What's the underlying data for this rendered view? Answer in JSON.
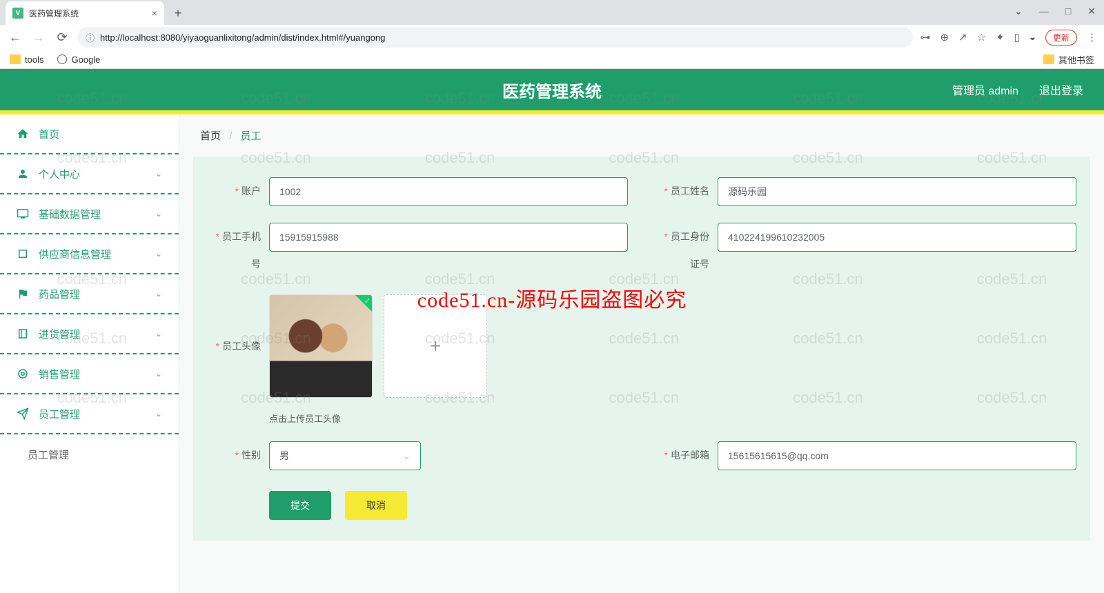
{
  "browser": {
    "tab_title": "医药管理系统",
    "url_host": "localhost",
    "url_full": "http://localhost:8080/yiyaoguanlixitong/admin/dist/index.html#/yuangong",
    "new_tab": "+",
    "update_label": "更新",
    "bookmarks": {
      "tools": "tools",
      "google": "Google",
      "other": "其他书签"
    }
  },
  "header": {
    "title": "医药管理系统",
    "user_label": "管理员 admin",
    "logout": "退出登录"
  },
  "sidebar": {
    "items": [
      {
        "label": "首页"
      },
      {
        "label": "个人中心"
      },
      {
        "label": "基础数据管理"
      },
      {
        "label": "供应商信息管理"
      },
      {
        "label": "药品管理"
      },
      {
        "label": "进货管理"
      },
      {
        "label": "销售管理"
      },
      {
        "label": "员工管理"
      }
    ],
    "sub_item": "员工管理"
  },
  "breadcrumb": {
    "home": "首页",
    "sep": "/",
    "current": "员工"
  },
  "form": {
    "account": {
      "label": "账户",
      "value": "1002"
    },
    "name": {
      "label": "员工姓名",
      "value": "源码乐园"
    },
    "phone": {
      "label": "员工手机号",
      "value": "15915915988"
    },
    "idcard": {
      "label": "员工身份证号",
      "value": "410224199610232005"
    },
    "avatar": {
      "label": "员工头像",
      "hint": "点击上传员工头像"
    },
    "gender": {
      "label": "性别",
      "value": "男"
    },
    "email": {
      "label": "电子邮箱",
      "value": "15615615615@qq.com"
    },
    "submit": "提交",
    "cancel": "取消"
  },
  "watermark": {
    "text": "code51.cn",
    "red_text": "code51.cn-源码乐园盗图必究"
  }
}
